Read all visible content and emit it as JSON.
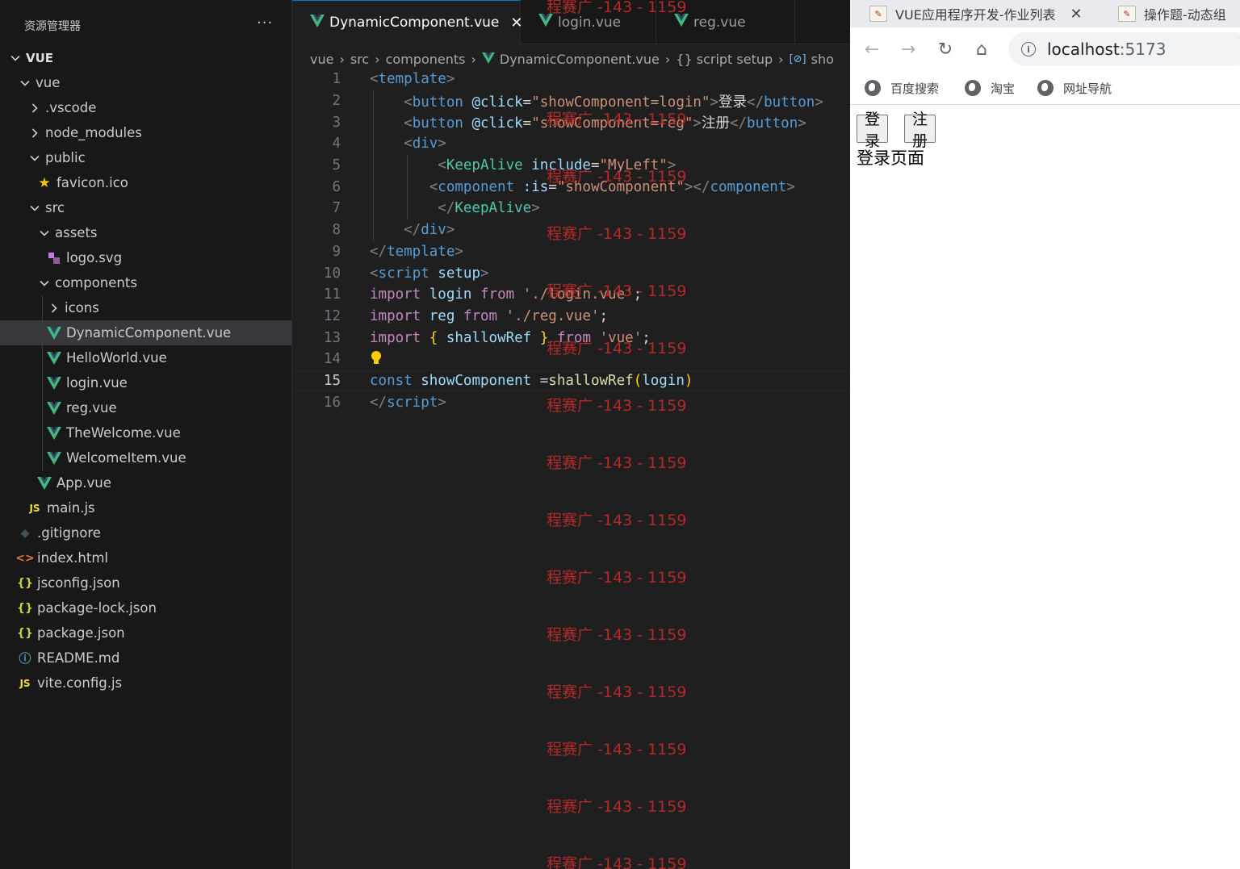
{
  "explorer": {
    "title": "资源管理器",
    "more": "···",
    "items": [
      {
        "label": "VUE",
        "type": "root-folder"
      },
      {
        "label": "vue",
        "type": "folder-open"
      },
      {
        "label": ".vscode",
        "type": "folder-closed"
      },
      {
        "label": "node_modules",
        "type": "folder-closed"
      },
      {
        "label": "public",
        "type": "folder-open"
      },
      {
        "label": "favicon.ico",
        "type": "file",
        "icon": "star-icon"
      },
      {
        "label": "src",
        "type": "folder-open"
      },
      {
        "label": "assets",
        "type": "folder-open"
      },
      {
        "label": "logo.svg",
        "type": "file",
        "icon": "svg-file-icon"
      },
      {
        "label": "components",
        "type": "folder-open"
      },
      {
        "label": "icons",
        "type": "folder-closed"
      },
      {
        "label": "DynamicComponent.vue",
        "type": "file",
        "icon": "vue-icon",
        "selected": true
      },
      {
        "label": "HelloWorld.vue",
        "type": "file",
        "icon": "vue-icon"
      },
      {
        "label": "login.vue",
        "type": "file",
        "icon": "vue-icon"
      },
      {
        "label": "reg.vue",
        "type": "file",
        "icon": "vue-icon"
      },
      {
        "label": "TheWelcome.vue",
        "type": "file",
        "icon": "vue-icon"
      },
      {
        "label": "WelcomeItem.vue",
        "type": "file",
        "icon": "vue-icon"
      },
      {
        "label": "App.vue",
        "type": "file",
        "icon": "vue-icon"
      },
      {
        "label": "main.js",
        "type": "file",
        "icon": "js-icon"
      },
      {
        "label": ".gitignore",
        "type": "file",
        "icon": "git-icon"
      },
      {
        "label": "index.html",
        "type": "file",
        "icon": "html-icon"
      },
      {
        "label": "jsconfig.json",
        "type": "file",
        "icon": "json-icon"
      },
      {
        "label": "package-lock.json",
        "type": "file",
        "icon": "json-icon"
      },
      {
        "label": "package.json",
        "type": "file",
        "icon": "json-icon"
      },
      {
        "label": "README.md",
        "type": "file",
        "icon": "info-icon"
      },
      {
        "label": "vite.config.js",
        "type": "file",
        "icon": "js-icon"
      }
    ]
  },
  "editor": {
    "tabs": [
      {
        "label": "DynamicComponent.vue",
        "active": true,
        "close": "✕"
      },
      {
        "label": "login.vue",
        "active": false
      },
      {
        "label": "reg.vue",
        "active": false
      }
    ],
    "breadcrumb": [
      "vue",
      "src",
      "components",
      "DynamicComponent.vue",
      "{} script setup",
      "sho"
    ],
    "current_line": 15,
    "lines": [
      {
        "n": "1",
        "tokens": [
          [
            "t-br",
            "<"
          ],
          [
            "t-tag",
            "template"
          ],
          [
            "t-br",
            ">"
          ]
        ]
      },
      {
        "n": "2",
        "tokens": [
          [
            "t-br",
            "    <"
          ],
          [
            "t-tag",
            "button"
          ],
          [
            "t-txt",
            " "
          ],
          [
            "t-attr",
            "@click"
          ],
          [
            "t-txt",
            "="
          ],
          [
            "t-str",
            "\"showComponent=login\""
          ],
          [
            "t-br",
            ">"
          ],
          [
            "t-txt",
            "登录"
          ],
          [
            "t-br",
            "</"
          ],
          [
            "t-tag",
            "button"
          ],
          [
            "t-br",
            ">"
          ]
        ]
      },
      {
        "n": "3",
        "tokens": [
          [
            "t-br",
            "    <"
          ],
          [
            "t-tag",
            "button"
          ],
          [
            "t-txt",
            " "
          ],
          [
            "t-attr",
            "@click"
          ],
          [
            "t-txt",
            "="
          ],
          [
            "t-str",
            "\"showComponent=reg\""
          ],
          [
            "t-br",
            ">"
          ],
          [
            "t-txt",
            "注册"
          ],
          [
            "t-br",
            "</"
          ],
          [
            "t-tag",
            "button"
          ],
          [
            "t-br",
            ">"
          ]
        ]
      },
      {
        "n": "4",
        "tokens": [
          [
            "t-br",
            "    <"
          ],
          [
            "t-tag",
            "div"
          ],
          [
            "t-br",
            ">"
          ]
        ]
      },
      {
        "n": "5",
        "tokens": [
          [
            "t-br",
            "        <"
          ],
          [
            "t-comp",
            "KeepAlive"
          ],
          [
            "t-txt",
            " "
          ],
          [
            "t-attr",
            "include"
          ],
          [
            "t-txt",
            "="
          ],
          [
            "t-str",
            "\"MyLeft\""
          ],
          [
            "t-br",
            ">"
          ]
        ]
      },
      {
        "n": "6",
        "tokens": [
          [
            "t-br",
            "       <"
          ],
          [
            "t-tag",
            "component"
          ],
          [
            "t-txt",
            " "
          ],
          [
            "t-attr",
            ":is"
          ],
          [
            "t-txt",
            "="
          ],
          [
            "t-str",
            "\"showComponent\""
          ],
          [
            "t-br",
            "></"
          ],
          [
            "t-tag",
            "component"
          ],
          [
            "t-br",
            ">"
          ]
        ]
      },
      {
        "n": "7",
        "tokens": [
          [
            "t-br",
            "        </"
          ],
          [
            "t-comp",
            "KeepAlive"
          ],
          [
            "t-br",
            ">"
          ]
        ]
      },
      {
        "n": "8",
        "tokens": [
          [
            "t-br",
            "    </"
          ],
          [
            "t-tag",
            "div"
          ],
          [
            "t-br",
            ">"
          ]
        ]
      },
      {
        "n": "9",
        "tokens": [
          [
            "t-br",
            "</"
          ],
          [
            "t-tag",
            "template"
          ],
          [
            "t-br",
            ">"
          ]
        ]
      },
      {
        "n": "10",
        "tokens": [
          [
            "t-br",
            "<"
          ],
          [
            "t-tag",
            "script"
          ],
          [
            "t-txt",
            " "
          ],
          [
            "t-attr",
            "setup"
          ],
          [
            "t-br",
            ">"
          ]
        ]
      },
      {
        "n": "11",
        "tokens": [
          [
            "t-kw",
            "import"
          ],
          [
            "t-txt",
            " "
          ],
          [
            "t-var",
            "login"
          ],
          [
            "t-txt",
            " "
          ],
          [
            "t-kw",
            "from"
          ],
          [
            "t-txt",
            " "
          ],
          [
            "t-str",
            "'./login.vue'"
          ],
          [
            "t-txt",
            ";"
          ]
        ]
      },
      {
        "n": "12",
        "tokens": [
          [
            "t-kw",
            "import"
          ],
          [
            "t-txt",
            " "
          ],
          [
            "t-var",
            "reg"
          ],
          [
            "t-txt",
            " "
          ],
          [
            "t-kw",
            "from"
          ],
          [
            "t-txt",
            " "
          ],
          [
            "t-str",
            "'./reg.vue'"
          ],
          [
            "t-txt",
            ";"
          ]
        ]
      },
      {
        "n": "13",
        "tokens": [
          [
            "t-kw",
            "import"
          ],
          [
            "t-txt",
            " "
          ],
          [
            "t-gold",
            "{"
          ],
          [
            "t-txt",
            " "
          ],
          [
            "t-var",
            "shallowRef"
          ],
          [
            "t-txt",
            " "
          ],
          [
            "t-gold",
            "}"
          ],
          [
            "t-txt",
            " "
          ],
          [
            "t-kw",
            "from"
          ],
          [
            "t-txt",
            " "
          ],
          [
            "t-str",
            "'vue'"
          ],
          [
            "t-txt",
            ";"
          ]
        ]
      },
      {
        "n": "14",
        "tokens": []
      },
      {
        "n": "15",
        "tokens": [
          [
            "t-const",
            "const"
          ],
          [
            "t-txt",
            " "
          ],
          [
            "t-var",
            "showComponent"
          ],
          [
            "t-txt",
            " ="
          ],
          [
            "t-fn",
            "shallowRef"
          ],
          [
            "t-gold",
            "("
          ],
          [
            "t-var",
            "login"
          ],
          [
            "t-gold",
            ")"
          ]
        ]
      },
      {
        "n": "16",
        "tokens": [
          [
            "t-br",
            "</"
          ],
          [
            "t-tag",
            "script"
          ],
          [
            "t-br",
            ">"
          ]
        ]
      }
    ],
    "watermark": "程赛广 -143 - 1159"
  },
  "browser": {
    "tabs": [
      {
        "label": "VUE应用程序开发-作业列表",
        "close": "✕"
      },
      {
        "label": "操作题-动态组"
      }
    ],
    "nav": {
      "back": "←",
      "forward": "→",
      "reload": "↻",
      "home": "⌂"
    },
    "address": {
      "host": "localhost",
      "port": ":5173"
    },
    "bookmarks": [
      "百度搜索",
      "淘宝",
      "网址导航"
    ],
    "page": {
      "buttons": [
        "登录",
        "注册"
      ],
      "text": "登录页面"
    }
  }
}
